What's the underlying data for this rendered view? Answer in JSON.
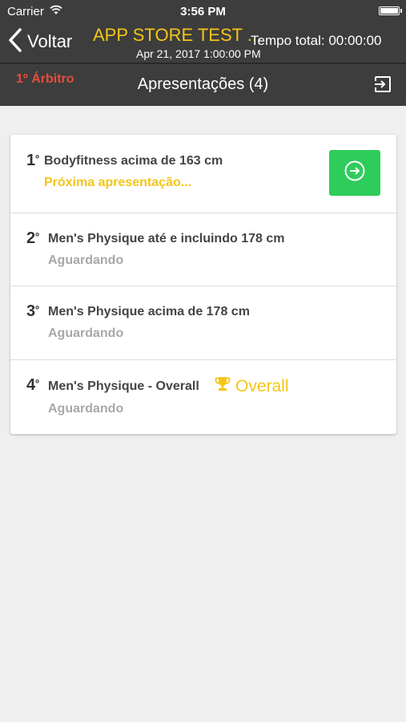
{
  "status_bar": {
    "carrier": "Carrier",
    "time": "3:56 PM"
  },
  "nav": {
    "back_label": "Voltar",
    "title": "APP STORE TEST ...",
    "subtitle": "Apr 21, 2017 1:00:00 PM",
    "total_time": "Tempo total: 00:00:00"
  },
  "toolbar": {
    "role": "1º Árbitro",
    "section_title": "Apresentações (4)"
  },
  "list": {
    "items": [
      {
        "ordinal": "1",
        "ordinal_suffix": "º",
        "name": "Bodyfitness acima de 163 cm",
        "status": "Próxima apresentação..."
      },
      {
        "ordinal": "2",
        "ordinal_suffix": "º",
        "name": "Men's Physique até e incluindo 178 cm",
        "status": "Aguardando"
      },
      {
        "ordinal": "3",
        "ordinal_suffix": "º",
        "name": "Men's Physique acima de 178 cm",
        "status": "Aguardando"
      },
      {
        "ordinal": "4",
        "ordinal_suffix": "º",
        "name": "Men's Physique - Overall",
        "badge": "Overall",
        "status": "Aguardando"
      }
    ]
  },
  "colors": {
    "header_bg": "#3d3d3d",
    "accent_yellow": "#f5c518",
    "role_red": "#e74c3c",
    "enter_green": "#2ecc5b",
    "waiting_gray": "#a8a8a8"
  },
  "icons": {
    "back": "chevron-left-icon",
    "exit": "exit-icon",
    "enter": "enter-arrow-icon",
    "trophy": "trophy-icon"
  }
}
